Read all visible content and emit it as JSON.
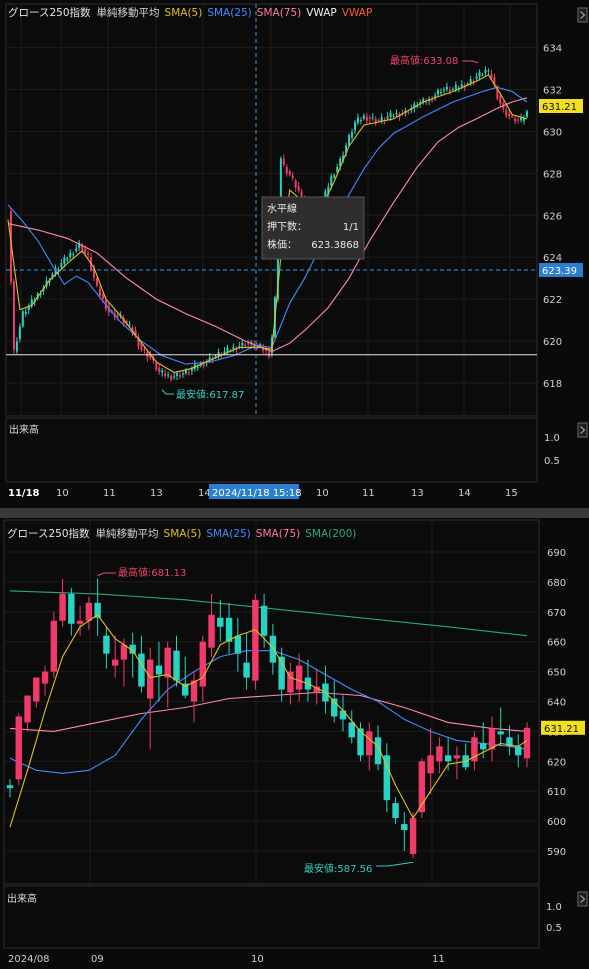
{
  "chart_data": [
    {
      "type": "candlestick",
      "title": "グロース250指数",
      "legend": [
        {
          "label": "単純移動平均",
          "color": "#d8d8d8"
        },
        {
          "label": "SMA(5)",
          "color": "#e0c020"
        },
        {
          "label": "SMA(25)",
          "color": "#3f8cff"
        },
        {
          "label": "SMA(75)",
          "color": "#ff7aa0"
        },
        {
          "label": "VWAP",
          "color": "#f0f0f0"
        },
        {
          "label": "VWAP",
          "color": "#ff5a2a"
        }
      ],
      "ylim": [
        617.0,
        635.2
      ],
      "yticks": [
        618,
        620,
        622,
        624,
        626,
        628,
        630,
        632,
        634
      ],
      "xticks": [
        "11/18",
        "10",
        "11",
        "13",
        "14",
        "10",
        "11",
        "13",
        "14",
        "15"
      ],
      "last_price": "631.21",
      "crosshair_price": "623.39",
      "crosshair_time": "2024/11/18 15:18",
      "horizontal_line": 619.35,
      "max_label": "最高値:633.08",
      "max_value": 633.08,
      "min_label": "最安値:617.87",
      "min_value": 617.87,
      "tooltip": {
        "title": "水平線",
        "row1_label": "押下数：",
        "row1_value": "1/1",
        "row2_label": "株価：",
        "row2_value": "623.3868"
      },
      "volume_label": "出来高",
      "volume_ticks": [
        "1.0",
        "0.5"
      ],
      "close_path": [
        [
          0,
          626.2
        ],
        [
          2,
          619.5
        ],
        [
          5,
          621.3
        ],
        [
          10,
          622.2
        ],
        [
          15,
          623.2
        ],
        [
          20,
          624.0
        ],
        [
          24,
          624.6
        ],
        [
          27,
          624.0
        ],
        [
          30,
          622.5
        ],
        [
          34,
          621.4
        ],
        [
          38,
          621.1
        ],
        [
          42,
          620.5
        ],
        [
          45,
          619.6
        ],
        [
          48,
          619.2
        ],
        [
          51,
          618.5
        ],
        [
          55,
          618.3
        ],
        [
          60,
          618.5
        ],
        [
          65,
          618.9
        ],
        [
          70,
          619.3
        ],
        [
          75,
          619.6
        ],
        [
          80,
          619.9
        ],
        [
          85,
          619.7
        ],
        [
          88,
          619.4
        ],
        [
          89,
          620.2
        ],
        [
          90,
          622.0
        ],
        [
          91,
          625.5
        ],
        [
          92,
          628.7
        ],
        [
          93,
          628.3
        ],
        [
          95,
          627.9
        ],
        [
          100,
          626.6
        ],
        [
          103,
          625.9
        ],
        [
          106,
          626.6
        ],
        [
          109,
          627.8
        ],
        [
          112,
          628.6
        ],
        [
          115,
          629.7
        ],
        [
          117,
          630.4
        ],
        [
          120,
          630.7
        ],
        [
          125,
          630.5
        ],
        [
          130,
          630.8
        ],
        [
          134,
          630.9
        ],
        [
          138,
          631.3
        ],
        [
          142,
          631.5
        ],
        [
          146,
          632.0
        ],
        [
          150,
          632.0
        ],
        [
          155,
          632.3
        ],
        [
          158,
          632.6
        ],
        [
          161,
          632.9
        ],
        [
          163,
          632.6
        ],
        [
          165,
          631.7
        ],
        [
          167,
          631.0
        ],
        [
          170,
          630.6
        ],
        [
          173,
          630.5
        ],
        [
          175,
          630.9
        ]
      ],
      "sma5_path": [
        [
          0,
          625.8
        ],
        [
          4,
          621.5
        ],
        [
          8,
          621.7
        ],
        [
          14,
          622.9
        ],
        [
          20,
          623.7
        ],
        [
          25,
          624.3
        ],
        [
          29,
          623.5
        ],
        [
          33,
          622.0
        ],
        [
          38,
          621.2
        ],
        [
          44,
          620.1
        ],
        [
          50,
          619.0
        ],
        [
          56,
          618.5
        ],
        [
          62,
          618.7
        ],
        [
          70,
          619.2
        ],
        [
          78,
          619.7
        ],
        [
          85,
          619.7
        ],
        [
          89,
          619.6
        ],
        [
          92,
          624.0
        ],
        [
          95,
          627.2
        ],
        [
          100,
          626.6
        ],
        [
          105,
          626.2
        ],
        [
          110,
          627.6
        ],
        [
          115,
          629.3
        ],
        [
          120,
          630.3
        ],
        [
          130,
          630.6
        ],
        [
          140,
          631.4
        ],
        [
          150,
          631.9
        ],
        [
          158,
          632.4
        ],
        [
          162,
          632.7
        ],
        [
          166,
          631.8
        ],
        [
          170,
          630.8
        ],
        [
          175,
          630.6
        ]
      ],
      "sma25_path": [
        [
          0,
          626.5
        ],
        [
          5,
          625.7
        ],
        [
          10,
          624.8
        ],
        [
          15,
          623.6
        ],
        [
          19,
          622.7
        ],
        [
          23,
          623.1
        ],
        [
          27,
          622.8
        ],
        [
          32,
          621.9
        ],
        [
          38,
          620.9
        ],
        [
          45,
          620.0
        ],
        [
          52,
          619.3
        ],
        [
          60,
          618.9
        ],
        [
          68,
          619.0
        ],
        [
          76,
          619.3
        ],
        [
          84,
          619.8
        ],
        [
          89,
          619.7
        ],
        [
          95,
          621.8
        ],
        [
          100,
          623.0
        ],
        [
          105,
          624.4
        ],
        [
          110,
          625.7
        ],
        [
          115,
          627.0
        ],
        [
          120,
          628.2
        ],
        [
          125,
          629.2
        ],
        [
          130,
          629.9
        ],
        [
          140,
          630.7
        ],
        [
          150,
          631.4
        ],
        [
          160,
          631.9
        ],
        [
          165,
          632.1
        ],
        [
          170,
          631.9
        ],
        [
          175,
          631.4
        ]
      ],
      "sma75_path": [
        [
          0,
          625.6
        ],
        [
          10,
          625.3
        ],
        [
          20,
          624.9
        ],
        [
          30,
          624.2
        ],
        [
          40,
          623.0
        ],
        [
          50,
          622.0
        ],
        [
          60,
          621.3
        ],
        [
          70,
          620.7
        ],
        [
          80,
          620.0
        ],
        [
          89,
          619.5
        ],
        [
          95,
          619.9
        ],
        [
          100,
          620.5
        ],
        [
          108,
          621.6
        ],
        [
          115,
          623.0
        ],
        [
          122,
          624.8
        ],
        [
          130,
          626.6
        ],
        [
          138,
          628.3
        ],
        [
          145,
          629.5
        ],
        [
          152,
          630.2
        ],
        [
          158,
          630.6
        ],
        [
          165,
          631.1
        ],
        [
          170,
          631.4
        ],
        [
          175,
          631.6
        ]
      ]
    },
    {
      "type": "candlestick",
      "title": "グロース250指数",
      "legend": [
        {
          "label": "単純移動平均",
          "color": "#d8d8d8"
        },
        {
          "label": "SMA(5)",
          "color": "#e0c020"
        },
        {
          "label": "SMA(25)",
          "color": "#3f8cff"
        },
        {
          "label": "SMA(75)",
          "color": "#ff7aa0"
        },
        {
          "label": "SMA(200)",
          "color": "#28a886"
        }
      ],
      "ylim": [
        580.0,
        695.0
      ],
      "yticks": [
        590,
        600,
        610,
        620,
        630,
        640,
        650,
        660,
        670,
        680,
        690
      ],
      "xticks": [
        "2024/08",
        "09",
        "10",
        "11"
      ],
      "last_price": "631.21",
      "max_label": "最高値:681.13",
      "max_value": 681.13,
      "min_label": "最安値:587.56",
      "min_value": 587.56,
      "volume_label": "出来高",
      "volume_ticks": [
        "1.0",
        "0.5"
      ],
      "ohlc": [
        [
          612,
          614,
          608,
          611
        ],
        [
          614,
          636,
          612,
          635
        ],
        [
          633,
          642,
          630,
          642
        ],
        [
          640,
          648,
          638,
          648
        ],
        [
          646,
          652,
          642,
          650
        ],
        [
          650,
          670,
          648,
          667
        ],
        [
          667,
          681,
          665,
          676
        ],
        [
          676,
          678,
          662,
          666
        ],
        [
          666,
          672,
          662,
          667
        ],
        [
          667,
          675,
          664,
          673
        ],
        [
          673,
          681.13,
          662,
          668
        ],
        [
          662,
          665,
          651,
          656
        ],
        [
          652,
          662,
          648,
          654
        ],
        [
          654,
          661,
          645,
          659
        ],
        [
          659,
          663,
          648,
          656
        ],
        [
          656,
          662,
          643,
          645
        ],
        [
          641,
          658,
          624,
          654
        ],
        [
          652,
          660,
          640,
          649
        ],
        [
          648,
          660,
          638,
          658
        ],
        [
          657,
          662,
          645,
          647
        ],
        [
          646,
          655,
          641,
          642
        ],
        [
          640,
          650,
          633,
          647
        ],
        [
          645,
          662,
          640,
          660
        ],
        [
          658,
          676,
          655,
          669
        ],
        [
          668,
          674,
          660,
          665
        ],
        [
          668,
          673,
          656,
          660
        ],
        [
          662,
          668,
          650,
          656
        ],
        [
          653,
          663,
          644,
          648
        ],
        [
          647,
          676,
          644,
          674
        ],
        [
          672,
          676,
          658,
          662
        ],
        [
          662,
          666,
          649,
          653
        ],
        [
          655,
          658,
          640,
          644
        ],
        [
          643,
          653,
          639,
          650
        ],
        [
          644,
          656,
          640,
          652
        ],
        [
          648,
          654,
          640,
          644
        ],
        [
          643,
          651,
          639,
          645
        ],
        [
          646,
          652,
          636,
          640
        ],
        [
          641,
          647,
          633,
          635
        ],
        [
          637,
          642,
          630,
          634
        ],
        [
          633,
          637,
          626,
          628
        ],
        [
          631,
          633,
          620,
          622
        ],
        [
          622,
          633,
          617,
          630
        ],
        [
          628,
          632,
          617,
          619
        ],
        [
          622,
          626,
          603,
          607
        ],
        [
          606,
          608,
          599,
          601
        ],
        [
          599,
          603,
          590,
          597
        ],
        [
          589,
          603,
          587.56,
          601
        ],
        [
          603,
          621,
          601,
          620
        ],
        [
          616,
          631,
          609,
          622
        ],
        [
          620,
          628,
          616,
          625
        ],
        [
          622,
          628,
          617,
          620
        ],
        [
          621,
          625,
          614,
          622
        ],
        [
          622,
          626,
          617,
          618
        ],
        [
          620,
          630,
          617,
          628
        ],
        [
          626,
          633,
          621,
          624
        ],
        [
          624,
          635,
          620,
          631
        ],
        [
          630,
          638,
          625,
          629
        ],
        [
          628,
          632,
          622,
          625
        ],
        [
          625,
          629,
          618,
          622
        ],
        [
          621,
          633,
          618,
          631.21
        ]
      ],
      "sma5_path": [
        [
          0,
          598
        ],
        [
          2,
          617
        ],
        [
          4,
          637
        ],
        [
          6,
          655
        ],
        [
          8,
          665
        ],
        [
          10,
          669
        ],
        [
          12,
          661
        ],
        [
          14,
          657
        ],
        [
          16,
          648
        ],
        [
          18,
          649
        ],
        [
          20,
          645
        ],
        [
          22,
          648
        ],
        [
          24,
          659
        ],
        [
          26,
          662
        ],
        [
          28,
          664
        ],
        [
          30,
          658
        ],
        [
          32,
          648
        ],
        [
          34,
          646
        ],
        [
          36,
          643
        ],
        [
          38,
          637
        ],
        [
          40,
          630
        ],
        [
          42,
          625
        ],
        [
          44,
          612
        ],
        [
          46,
          601
        ],
        [
          48,
          610
        ],
        [
          50,
          619
        ],
        [
          52,
          620
        ],
        [
          54,
          623
        ],
        [
          56,
          626
        ],
        [
          58,
          625
        ],
        [
          59,
          627
        ]
      ],
      "sma25_path": [
        [
          0,
          621
        ],
        [
          3,
          617
        ],
        [
          6,
          616
        ],
        [
          9,
          617
        ],
        [
          12,
          622
        ],
        [
          15,
          634
        ],
        [
          18,
          644
        ],
        [
          21,
          650
        ],
        [
          24,
          655
        ],
        [
          27,
          657
        ],
        [
          30,
          657
        ],
        [
          33,
          654
        ],
        [
          36,
          649
        ],
        [
          39,
          644
        ],
        [
          42,
          640
        ],
        [
          45,
          634
        ],
        [
          48,
          630
        ],
        [
          51,
          627
        ],
        [
          54,
          626
        ],
        [
          57,
          625
        ],
        [
          59,
          624
        ]
      ],
      "sma75_path": [
        [
          0,
          631
        ],
        [
          5,
          630
        ],
        [
          10,
          633
        ],
        [
          15,
          636
        ],
        [
          20,
          638
        ],
        [
          25,
          641
        ],
        [
          30,
          642
        ],
        [
          35,
          643
        ],
        [
          40,
          642
        ],
        [
          45,
          638
        ],
        [
          50,
          633
        ],
        [
          55,
          631
        ],
        [
          59,
          630
        ]
      ],
      "sma200_path": [
        [
          0,
          677
        ],
        [
          10,
          676
        ],
        [
          20,
          674
        ],
        [
          30,
          671
        ],
        [
          40,
          668
        ],
        [
          50,
          665
        ],
        [
          59,
          662
        ]
      ]
    }
  ]
}
